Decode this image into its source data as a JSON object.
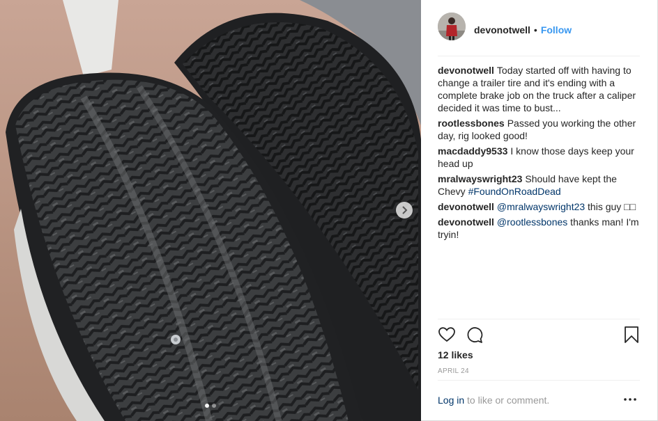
{
  "post": {
    "username": "devonotwell",
    "separator": "•",
    "follow_label": "Follow",
    "likes": "12 likes",
    "date": "APRIL 24",
    "login_link": "Log in",
    "login_suffix": " to like or comment."
  },
  "comments": [
    {
      "user": "devonotwell",
      "text": "Today started off with having to change a trailer tire and it's ending with a complete brake job on the truck after a caliper decided it was time to bust..."
    },
    {
      "user": "rootlessbones",
      "text": "Passed you working the other day, rig looked good!"
    },
    {
      "user": "macdaddy9533",
      "text": "I know those days keep your head up"
    },
    {
      "user": "mralwayswright23",
      "text": "Should have kept the Chevy ",
      "link": "#FoundOnRoadDead"
    },
    {
      "user": "devonotwell",
      "link": "@mralwayswright23",
      "text": " this guy □□"
    },
    {
      "user": "devonotwell",
      "link": "@rootlessbones",
      "text": " thanks man! I'm tryin!"
    }
  ],
  "icons": {
    "like": "heart-icon",
    "comment": "comment-icon",
    "save": "bookmark-icon",
    "more": "more-options-icon",
    "next": "chevron-right-icon"
  },
  "colors": {
    "link_blue": "#3897f0",
    "dark_link": "#003569",
    "muted": "#999999"
  },
  "carousel": {
    "count": 2,
    "active": 0
  }
}
